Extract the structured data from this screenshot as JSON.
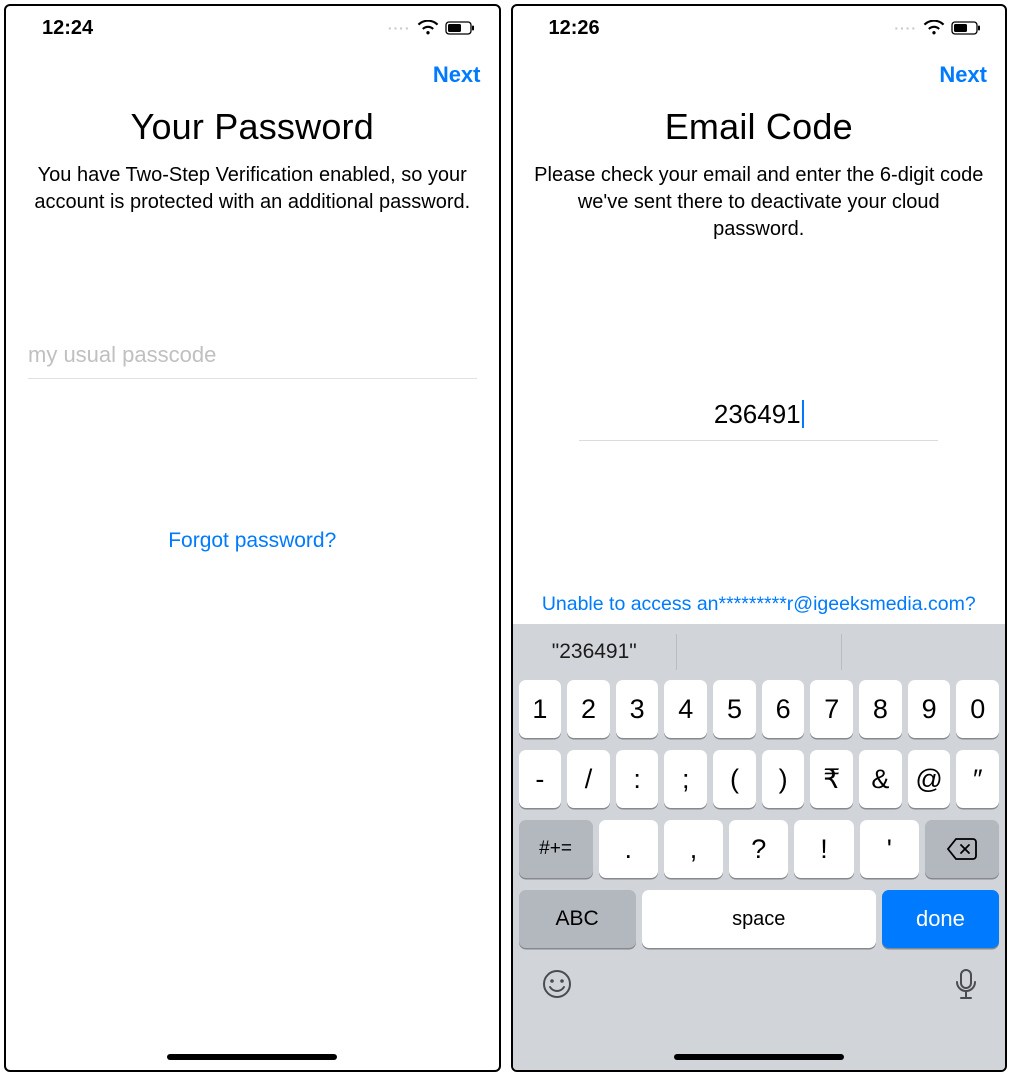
{
  "left": {
    "status": {
      "time": "12:24",
      "dots": "····"
    },
    "nav": {
      "next": "Next"
    },
    "title": "Your Password",
    "desc": "You have Two-Step Verification enabled, so your account is protected with an additional password.",
    "password_placeholder": "my usual passcode",
    "password_value": "",
    "forgot": "Forgot password?"
  },
  "right": {
    "status": {
      "time": "12:26",
      "dots": "····"
    },
    "nav": {
      "next": "Next"
    },
    "title": "Email Code",
    "desc": "Please check your email and enter the 6-digit code we've sent there to deactivate your cloud password.",
    "code_value": "236491",
    "unable": "Unable to access an*********r@igeeksmedia.com?",
    "keyboard": {
      "suggestion": "\"236491\"",
      "row1": [
        "1",
        "2",
        "3",
        "4",
        "5",
        "6",
        "7",
        "8",
        "9",
        "0"
      ],
      "row2": [
        "-",
        "/",
        ":",
        ";",
        "(",
        ")",
        "₹",
        "&",
        "@",
        "″"
      ],
      "shift": "#+=",
      "row3": [
        ".",
        ",",
        "?",
        "!",
        "'"
      ],
      "abc": "ABC",
      "space": "space",
      "done": "done"
    }
  }
}
